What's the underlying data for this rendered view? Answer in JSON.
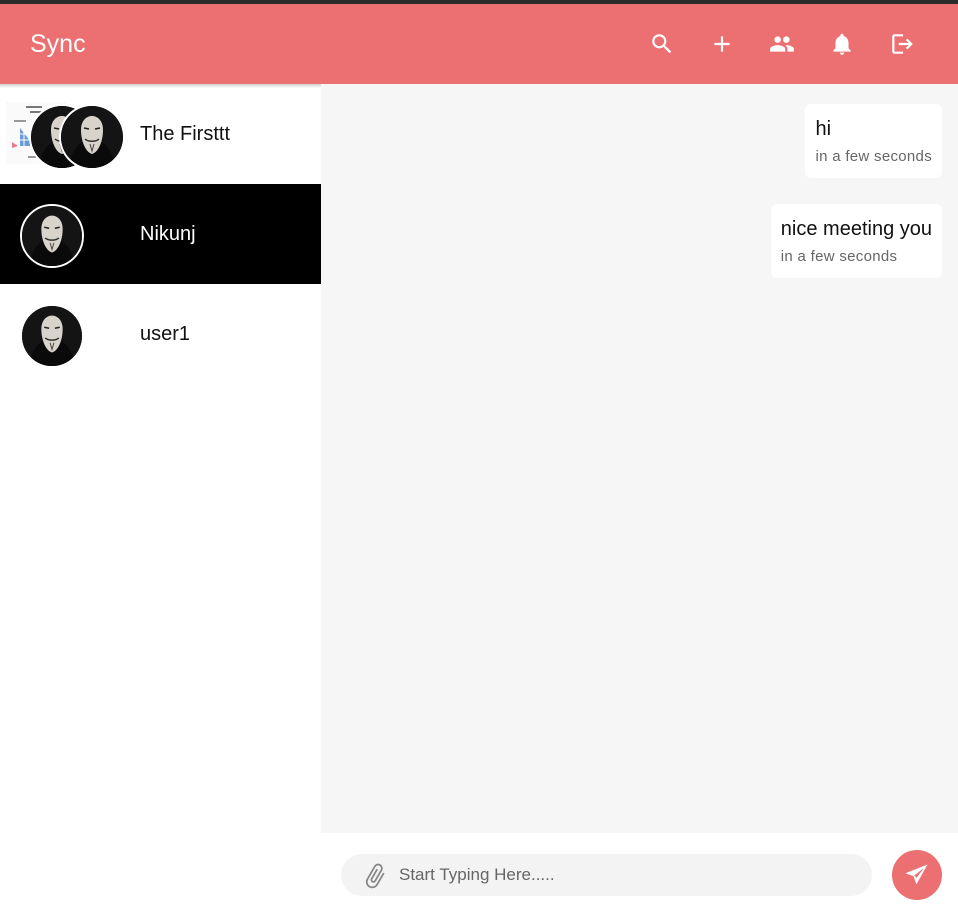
{
  "app": {
    "title": "Sync",
    "accent_color": "#ec7071"
  },
  "toolbar": {
    "icons": [
      "search-icon",
      "add-icon",
      "group-icon",
      "bell-icon",
      "logout-icon"
    ]
  },
  "chats": [
    {
      "name": "The Firsttt",
      "type": "group",
      "active": false
    },
    {
      "name": "Nikunj",
      "type": "direct",
      "active": true
    },
    {
      "name": "user1",
      "type": "direct",
      "active": false
    }
  ],
  "messages": [
    {
      "text": "hi",
      "time": "in a few seconds"
    },
    {
      "text": "nice meeting you",
      "time": "in a few seconds"
    }
  ],
  "composer": {
    "placeholder": "Start Typing Here.....",
    "value": "",
    "attach_icon": "paperclip-icon",
    "send_icon": "send-icon"
  }
}
